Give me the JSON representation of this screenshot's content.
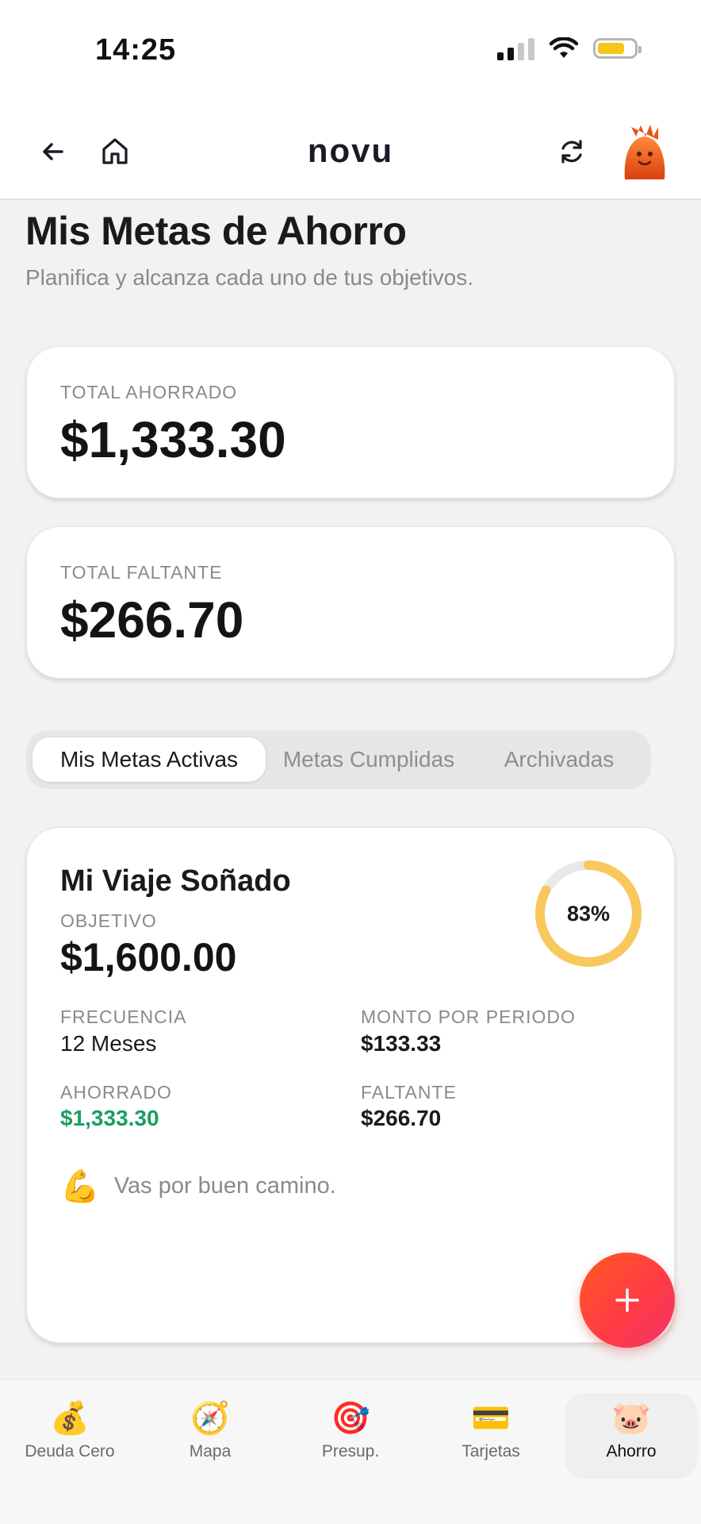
{
  "status_bar": {
    "time": "14:25",
    "battery_level": 0.75
  },
  "nav": {
    "brand": "novu",
    "back_icon": "arrow-left-icon",
    "home_icon": "home-icon",
    "refresh_icon": "refresh-icon",
    "avatar_icon": "orange-mascot-avatar"
  },
  "header": {
    "title": "Mis Metas de Ahorro",
    "subtitle": "Planifica y alcanza cada uno de tus objetivos."
  },
  "summary": {
    "saved_label": "TOTAL AHORRADO",
    "saved_value": "$1,333.30",
    "missing_label": "TOTAL FALTANTE",
    "missing_value": "$266.70"
  },
  "tabs": [
    {
      "label": "Mis Metas Activas",
      "active": true
    },
    {
      "label": "Metas Cumplidas",
      "active": false
    },
    {
      "label": "Archivadas",
      "active": false
    }
  ],
  "goal": {
    "name": "Mi Viaje Soñado",
    "target_label": "OBJETIVO",
    "target_value": "$1,600.00",
    "progress_text": "83%",
    "progress": 0.83,
    "frequency_label": "FRECUENCIA",
    "frequency_value": "12 Meses",
    "period_label": "MONTO POR PERIODO",
    "period_value": "$133.33",
    "saved_label": "AHORRADO",
    "saved_value": "$1,333.30",
    "missing_label": "FALTANTE",
    "missing_value": "$266.70",
    "motivation_emoji": "💪",
    "motivation_text": "Vas por buen camino."
  },
  "fab": {
    "icon": "plus-icon"
  },
  "bottom_tabs": [
    {
      "label": "Deuda Cero",
      "icon": "💰",
      "active": false
    },
    {
      "label": "Mapa",
      "icon": "🧭",
      "active": false
    },
    {
      "label": "Presup.",
      "icon": "🎯",
      "active": false
    },
    {
      "label": "Tarjetas",
      "icon": "💳",
      "active": false
    },
    {
      "label": "Ahorro",
      "icon": "🐷",
      "active": true
    }
  ],
  "colors": {
    "accent_green": "#1a9e63",
    "ring_yellow": "#f9c85c",
    "fab_orange": "#ff5a1f"
  }
}
